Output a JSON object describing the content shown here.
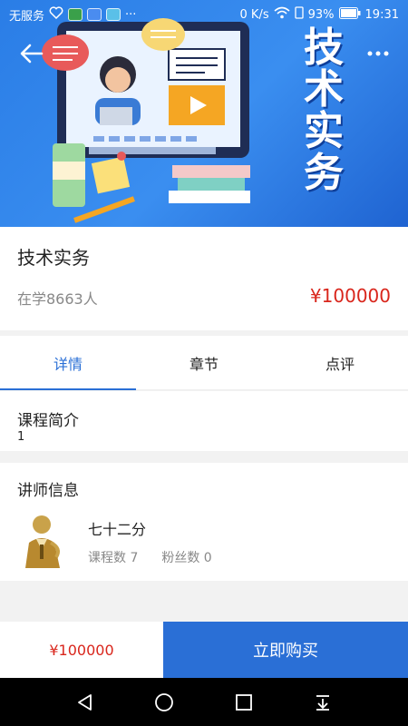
{
  "status_bar": {
    "carrier": "无服务",
    "net_speed": "0 K/s",
    "battery": "93%",
    "time": "19:31",
    "dots": "···"
  },
  "banner": {
    "title_chars": [
      "技",
      "术",
      "实",
      "务"
    ],
    "back_icon": "arrow-left-icon",
    "more_icon": "more-dots-icon"
  },
  "course": {
    "title": "技术实务",
    "students": "在学8663人",
    "price": "¥100000"
  },
  "tabs": [
    {
      "label": "详情",
      "active": true
    },
    {
      "label": "章节",
      "active": false
    },
    {
      "label": "点评",
      "active": false
    }
  ],
  "intro": {
    "title": "课程简介",
    "text": "1"
  },
  "teacher": {
    "title": "讲师信息",
    "name": "七十二分",
    "courses": "课程数 7",
    "fans": "粉丝数 0"
  },
  "bottom": {
    "price": "¥100000",
    "buy_label": "立即购买"
  },
  "colors": {
    "accent": "#2a6fd6",
    "price_red": "#d9261c",
    "banner_blue": "#2a7de6"
  }
}
